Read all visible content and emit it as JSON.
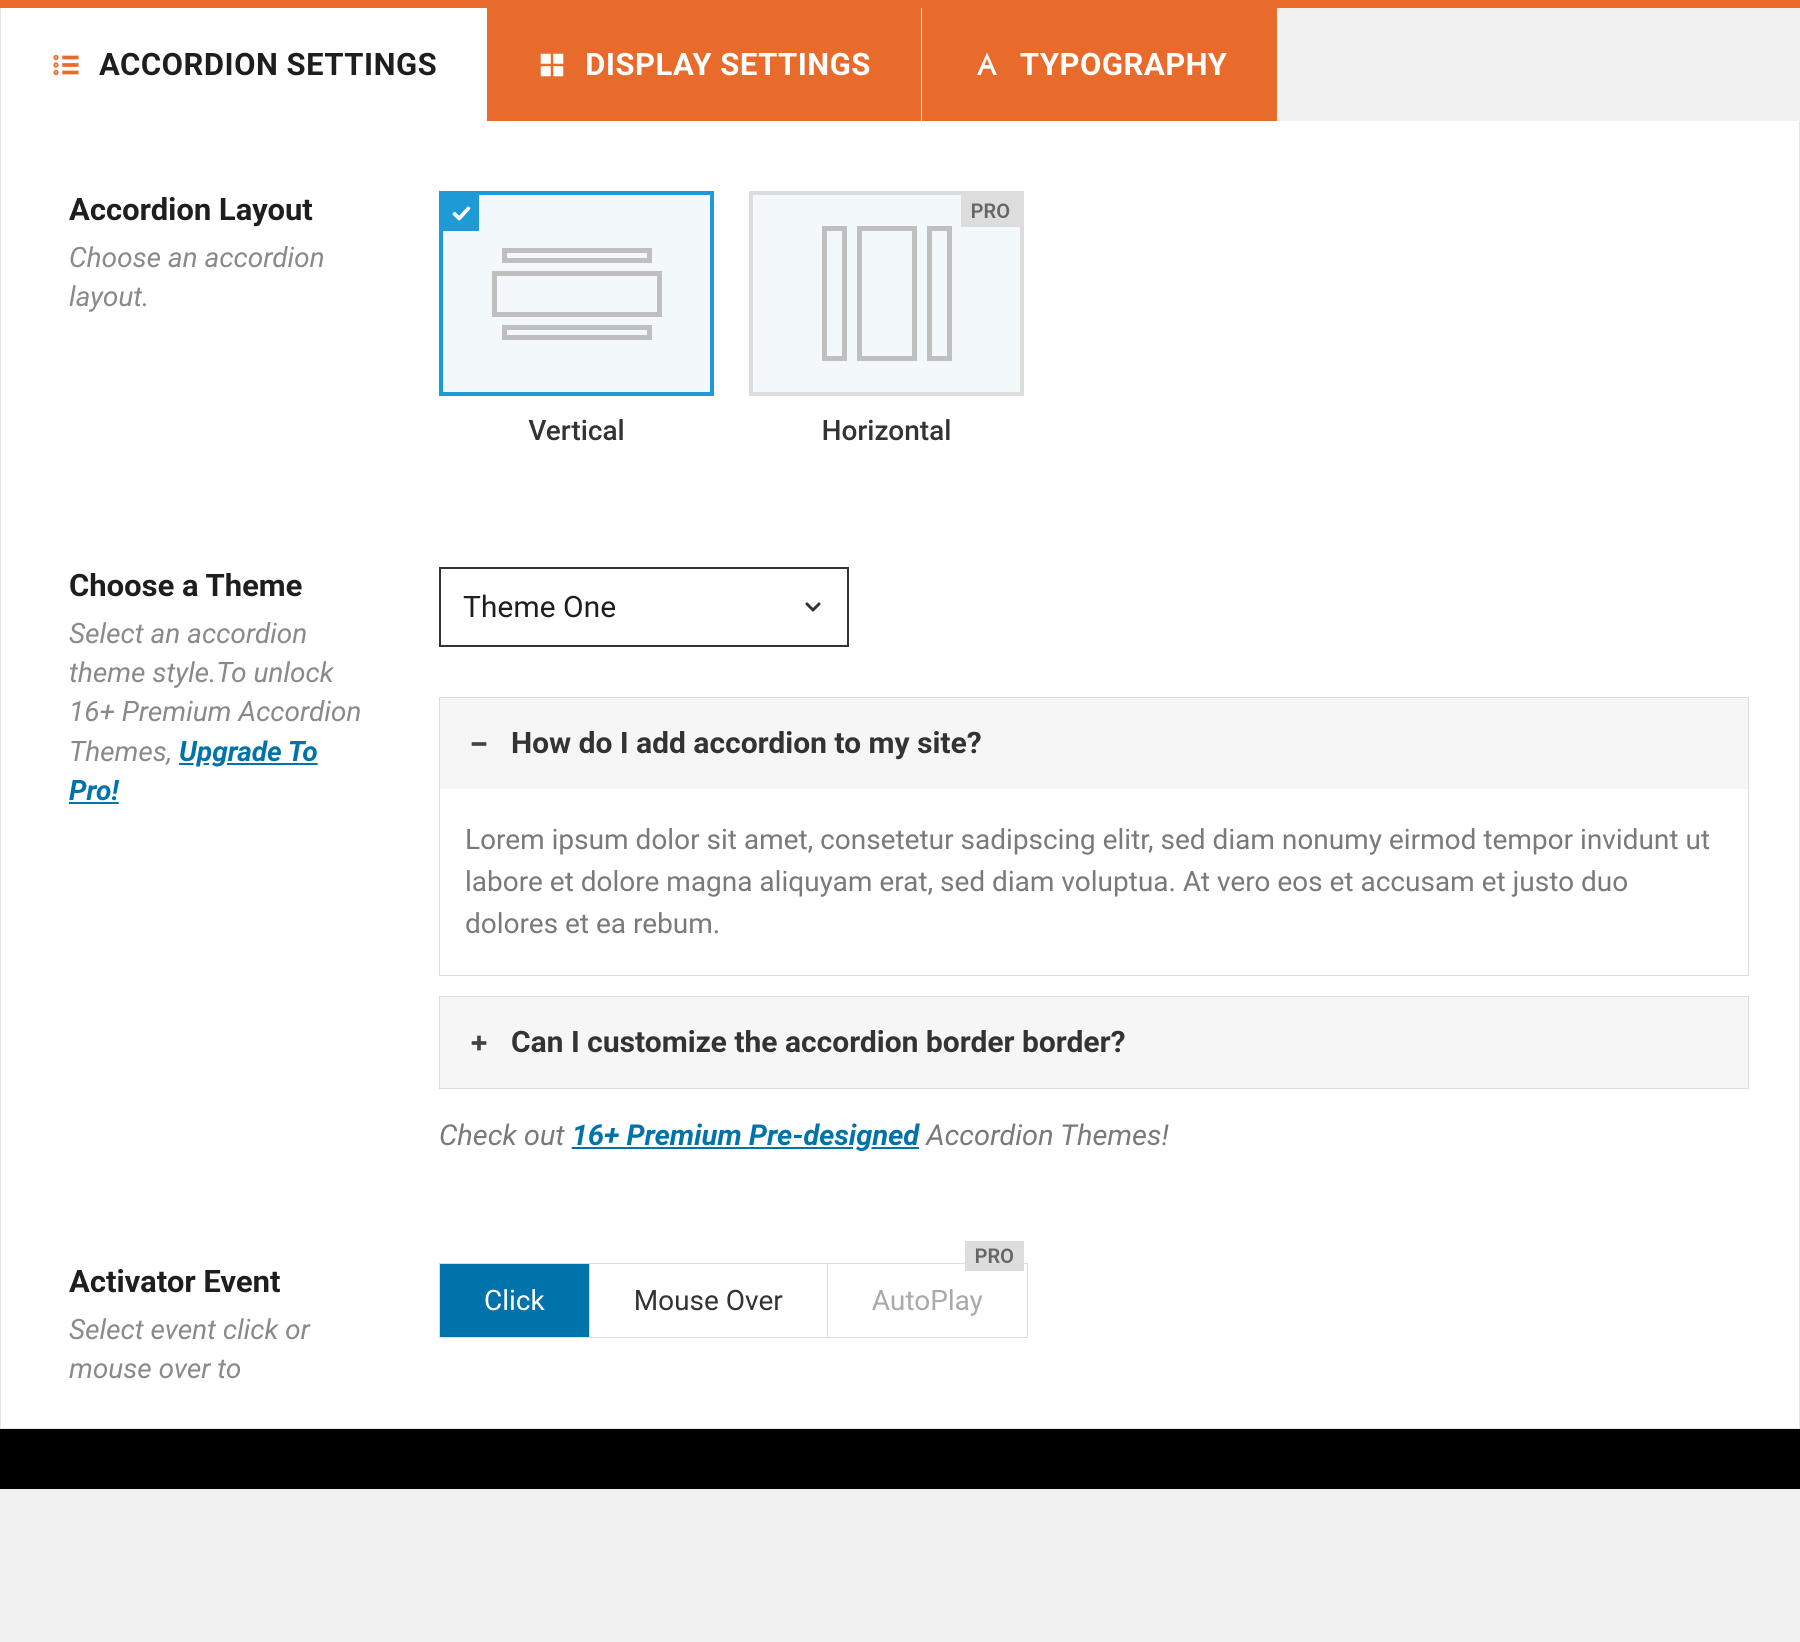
{
  "tabs": [
    {
      "label": "ACCORDION SETTINGS"
    },
    {
      "label": "DISPLAY SETTINGS"
    },
    {
      "label": "TYPOGRAPHY"
    }
  ],
  "layout": {
    "title": "Accordion Layout",
    "desc": "Choose an accordion layout.",
    "options": {
      "vertical": "Vertical",
      "horizontal": "Horizontal"
    },
    "pro_badge": "PRO"
  },
  "theme": {
    "title": "Choose a Theme",
    "desc_prefix": "Select an accordion theme style.To unlock 16+ Premium Accordion Themes, ",
    "upgrade_link": "Upgrade To Pro!",
    "select_value": "Theme One",
    "preview": {
      "item1_title": "How do I add accordion to my site?",
      "item1_body": "Lorem ipsum dolor sit amet, consetetur sadipscing elitr, sed diam nonumy eirmod tempor invidunt ut labore et dolore magna aliquyam erat, sed diam voluptua. At vero eos et accusam et justo duo dolores et ea rebum.",
      "item2_title": "Can I customize the accordion border border?"
    },
    "checkout_prefix": "Check out ",
    "checkout_link": "16+ Premium Pre-designed",
    "checkout_suffix": " Accordion Themes!"
  },
  "activator": {
    "title": "Activator Event",
    "desc": "Select event click or mouse over to",
    "buttons": {
      "click": "Click",
      "mouseover": "Mouse Over",
      "autoplay": "AutoPlay"
    },
    "pro_badge": "PRO"
  }
}
